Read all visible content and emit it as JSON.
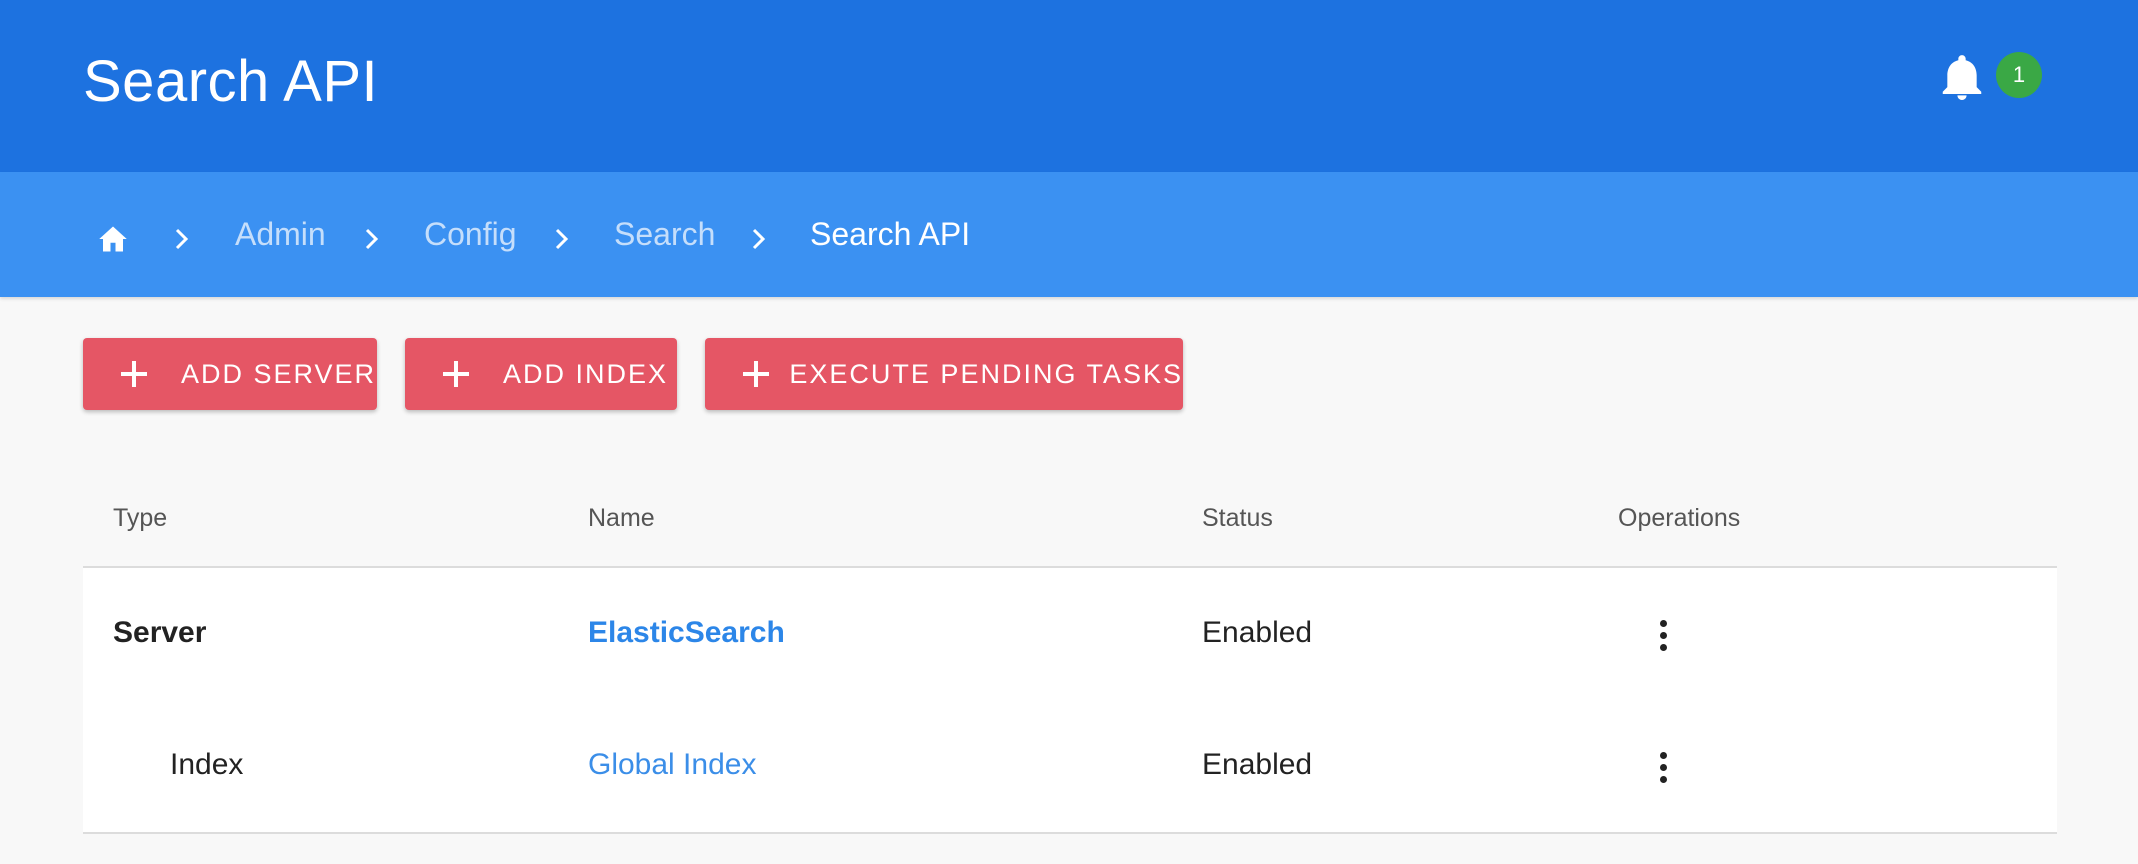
{
  "header": {
    "title": "Search API",
    "notification_count": "1"
  },
  "breadcrumb": {
    "home_icon": "home-icon",
    "items": [
      "Admin",
      "Config",
      "Search"
    ],
    "current": "Search API"
  },
  "actions": {
    "add_server": "ADD SERVER",
    "add_index": "ADD INDEX",
    "execute_pending": "EXECUTE PENDING TASKS"
  },
  "table": {
    "headers": [
      "Type",
      "Name",
      "Status",
      "Operations"
    ],
    "rows": [
      {
        "type": "Server",
        "name": "ElasticSearch",
        "status": "Enabled"
      },
      {
        "type": "Index",
        "name": "Global Index",
        "status": "Enabled"
      }
    ]
  },
  "colors": {
    "header_bg": "#1d72e0",
    "breadcrumb_bg": "#3b91f2",
    "button_bg": "#e55665",
    "badge_bg": "#3aa845",
    "link": "#3b8ee8"
  }
}
